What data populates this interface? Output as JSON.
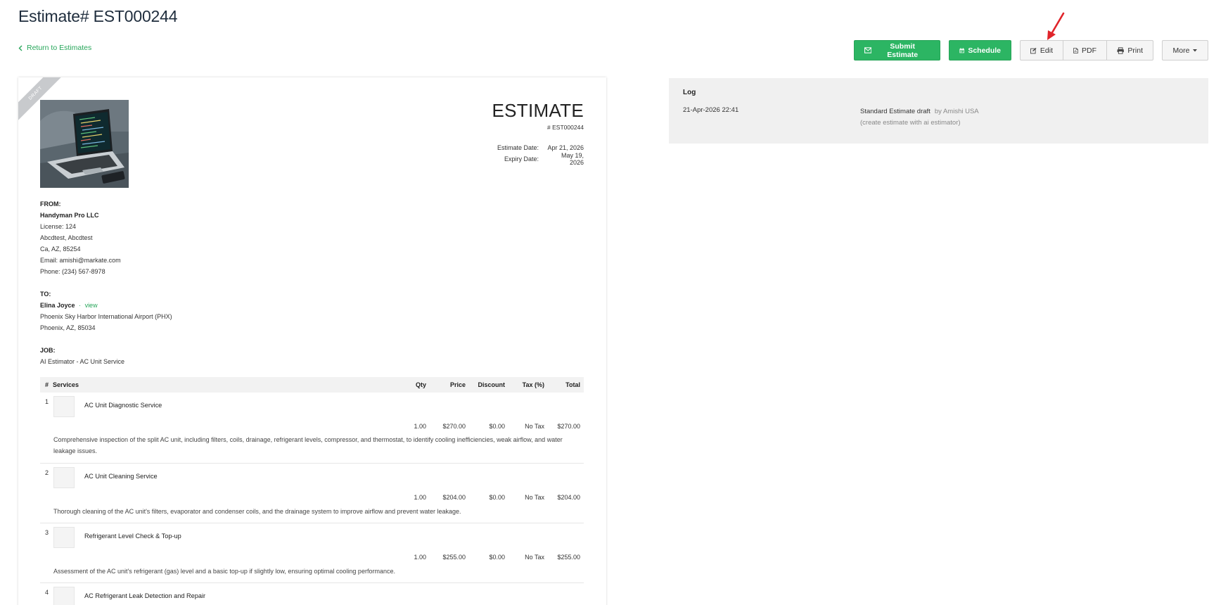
{
  "page": {
    "title": "Estimate# EST000244",
    "back_link": "Return to Estimates"
  },
  "toolbar": {
    "submit_label": "Submit Estimate",
    "schedule_label": "Schedule",
    "edit_label": "Edit",
    "pdf_label": "PDF",
    "print_label": "Print",
    "more_label": "More"
  },
  "colors": {
    "accent_green": "#2cb563",
    "annotation_arrow": "#e0242a"
  },
  "document": {
    "ribbon": "DRAFT",
    "heading": "ESTIMATE",
    "number": "# EST000244",
    "estimate_date_label": "Estimate Date:",
    "estimate_date": "Apr 21, 2026",
    "expiry_date_label": "Expiry Date:",
    "expiry_date": "May 19, 2026",
    "from": {
      "heading": "FROM:",
      "company": "Handyman Pro LLC",
      "license": "License: 124",
      "address1": "Abcdtest, Abcdtest",
      "address2": "Ca, AZ, 85254",
      "email": "Email: amishi@markate.com",
      "phone": "Phone: (234) 567-8978"
    },
    "to": {
      "heading": "TO:",
      "name": "Elina Joyce",
      "separator": "·",
      "view_link": "view",
      "address1": "Phoenix Sky Harbor International Airport (PHX)",
      "address2": "Phoenix, AZ, 85034"
    },
    "job": {
      "heading": "JOB:",
      "name": "AI Estimator - AC Unit Service"
    },
    "table_headers": {
      "num": "#",
      "services": "Services",
      "qty": "Qty",
      "price": "Price",
      "discount": "Discount",
      "tax": "Tax (%)",
      "total": "Total"
    },
    "items": [
      {
        "num": "1",
        "name": "AC Unit Diagnostic Service",
        "qty": "1.00",
        "price": "$270.00",
        "discount": "$0.00",
        "tax": "No Tax",
        "total": "$270.00",
        "description": "Comprehensive inspection of the split AC unit, including filters, coils, drainage, refrigerant levels, compressor, and thermostat, to identify cooling inefficiencies, weak airflow, and water leakage issues."
      },
      {
        "num": "2",
        "name": "AC Unit Cleaning Service",
        "qty": "1.00",
        "price": "$204.00",
        "discount": "$0.00",
        "tax": "No Tax",
        "total": "$204.00",
        "description": "Thorough cleaning of the AC unit's filters, evaporator and condenser coils, and the drainage system to improve airflow and prevent water leakage."
      },
      {
        "num": "3",
        "name": "Refrigerant Level Check & Top-up",
        "qty": "1.00",
        "price": "$255.00",
        "discount": "$0.00",
        "tax": "No Tax",
        "total": "$255.00",
        "description": "Assessment of the AC unit's refrigerant (gas) level and a basic top-up if slightly low, ensuring optimal cooling performance."
      },
      {
        "num": "4",
        "name": "AC Refrigerant Leak Detection and Repair"
      }
    ]
  },
  "log": {
    "title": "Log",
    "entries": [
      {
        "time": "21-Apr-2026 22:41",
        "event": "Standard Estimate draft",
        "by": "by Amishi USA",
        "note": "(create estimate with ai estimator)"
      }
    ]
  },
  "icons": [
    "chevron-left-icon",
    "envelope-icon",
    "calendar-icon",
    "edit-icon",
    "pdf-file-icon",
    "printer-icon",
    "caret-down-icon",
    "red-arrow-annotation"
  ]
}
